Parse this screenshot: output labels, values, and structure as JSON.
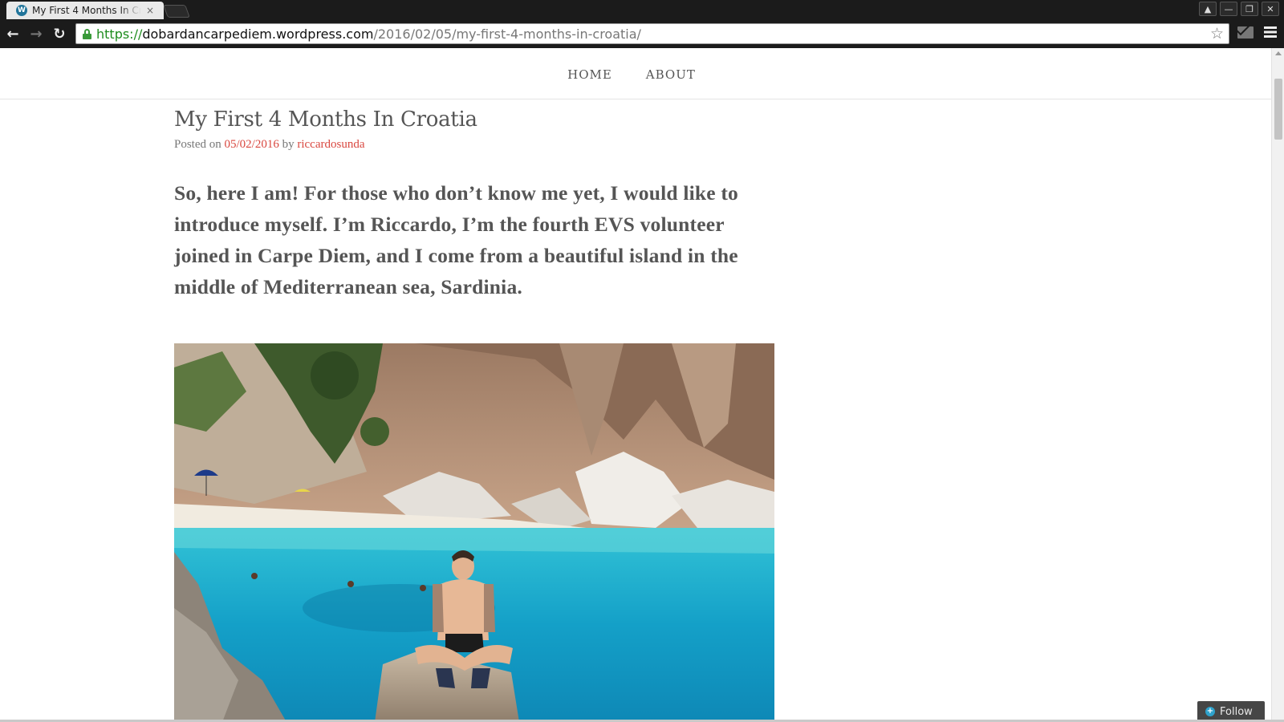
{
  "browser": {
    "tab_title": "My First 4 Months In Croatia",
    "favicon": "W",
    "close_glyph": "×",
    "url_scheme": "https://",
    "url_host": "dobardancarpediem.wordpress.com",
    "url_path": "/2016/02/05/my-first-4-months-in-croatia/"
  },
  "site_nav": {
    "items": [
      {
        "label": "HOME"
      },
      {
        "label": "ABOUT"
      }
    ]
  },
  "post": {
    "title": "My First 4 Months In Croatia",
    "posted_on_label": "Posted on",
    "date": "05/02/2016",
    "by_label": "by",
    "author": "riccardosunda",
    "lead": "So, here I am! For those who don’t know me yet, I would like to introduce myself.  I’m Riccardo, I’m the fourth EVS volunteer joined in Carpe Diem, and I come from a beautiful island in the middle of Mediterranean sea, Sardinia."
  },
  "follow": {
    "label": "Follow"
  },
  "colors": {
    "link": "#d9473f",
    "text": "#555555",
    "chrome": "#1b1b1b",
    "sea": "#1ba3c6"
  }
}
